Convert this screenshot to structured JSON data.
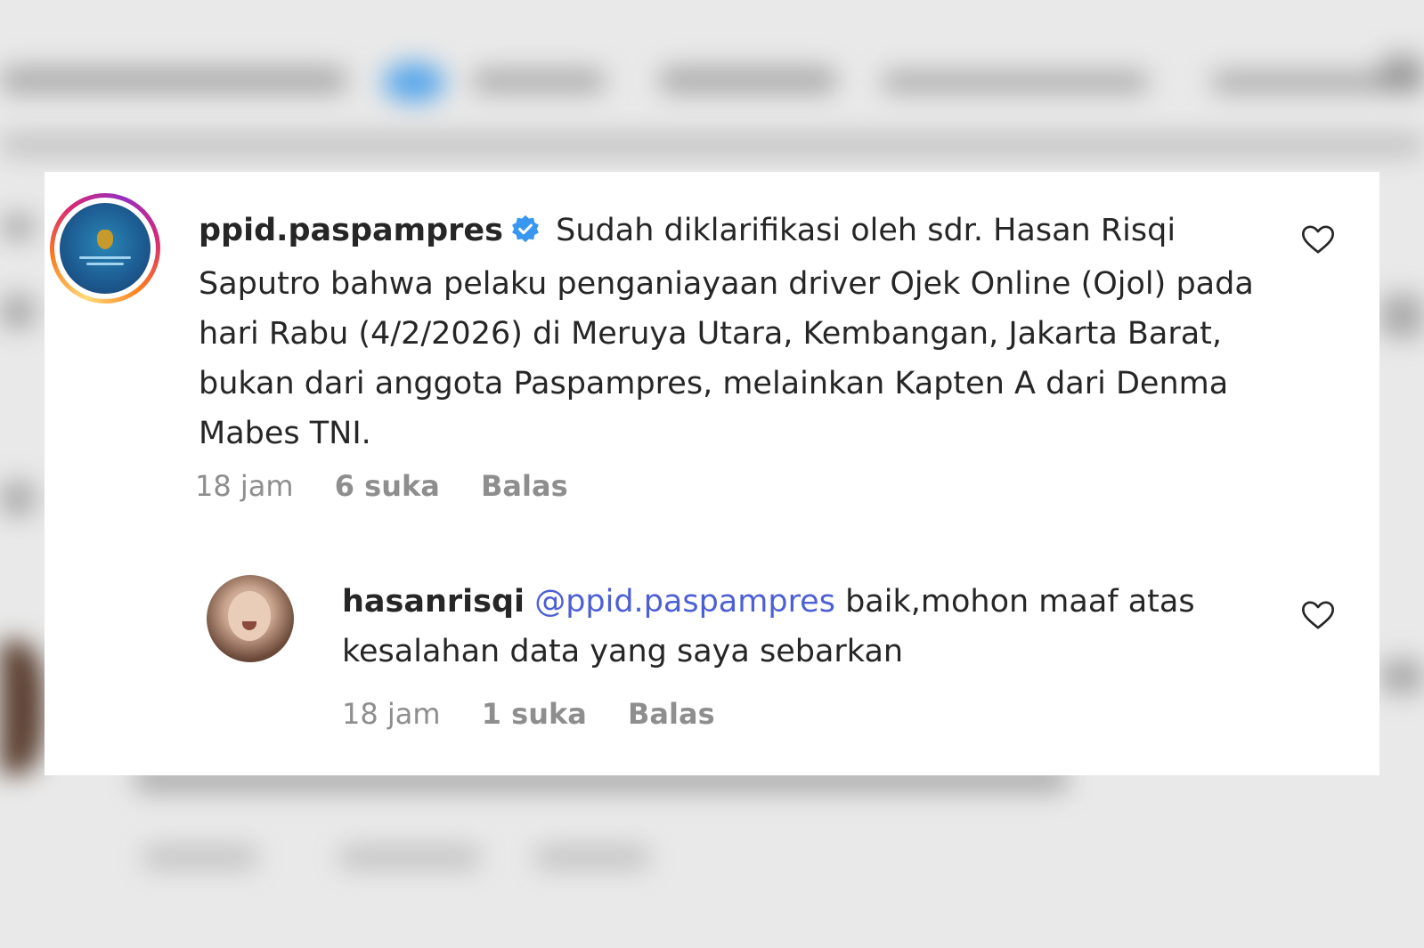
{
  "comment": {
    "username": "ppid.paspampres",
    "verified_icon": "verified-badge-icon",
    "text": "Sudah diklarifikasi oleh sdr. Hasan Risqi Saputro bahwa pelaku penganiayaan driver Ojek Online (Ojol) pada hari Rabu (4/2/2026) di Meruya Utara, Kembangan, Jakarta Barat, bukan dari anggota Paspampres, melainkan Kapten A dari Denma Mabes TNI.",
    "time": "18 jam",
    "likes": "6 suka",
    "reply_label": "Balas"
  },
  "reply": {
    "username": "hasanrisqi",
    "mention": "@ppid.paspampres",
    "text": "baik,mohon maaf atas kesalahan data yang saya sebarkan",
    "time": "18 jam",
    "likes": "1 suka",
    "reply_label": "Balas"
  },
  "colors": {
    "text": "#262626",
    "meta": "#8e8e8e",
    "mention": "#4c5fd5",
    "verified": "#3897f0"
  }
}
